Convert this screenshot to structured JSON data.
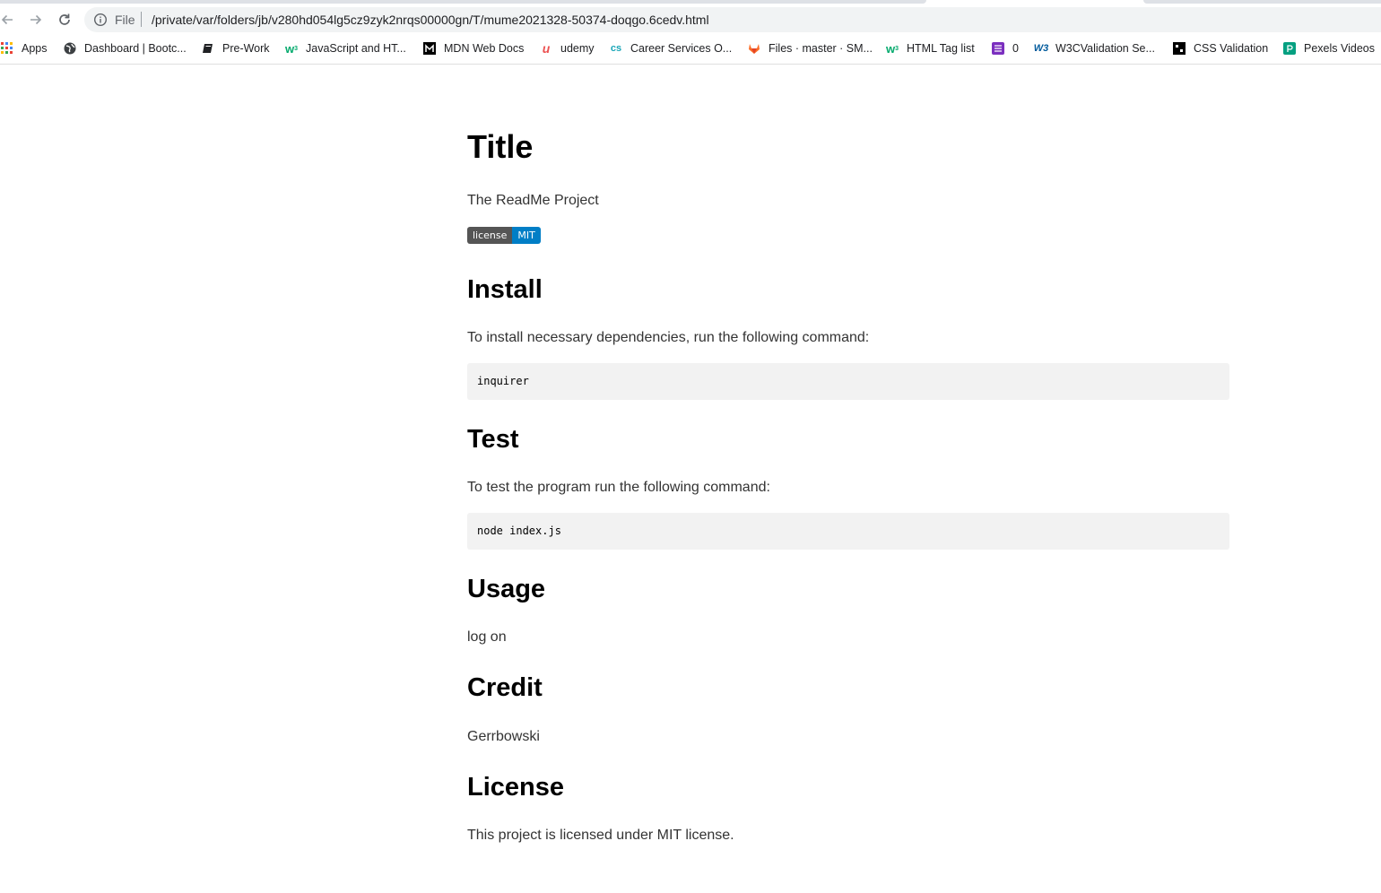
{
  "browser": {
    "address_scheme": "File",
    "address_url": "/private/var/folders/jb/v280hd054lg5cz9zyk2nrqs00000gn/T/mume2021328-50374-doqgo.6cedv.html",
    "bookmarks": [
      {
        "label": "Apps",
        "icon": "apps-grid-icon"
      },
      {
        "label": "Dashboard | Bootc...",
        "icon": "globe-icon"
      },
      {
        "label": "Pre-Work",
        "icon": "book-icon"
      },
      {
        "label": "JavaScript and HT...",
        "icon": "w3schools-icon"
      },
      {
        "label": "MDN Web Docs",
        "icon": "mdn-icon"
      },
      {
        "label": "udemy",
        "icon": "udemy-icon"
      },
      {
        "label": "Career Services O...",
        "icon": "cs-icon"
      },
      {
        "label": "Files · master · SM...",
        "icon": "gitlab-icon"
      },
      {
        "label": "HTML Tag list",
        "icon": "w3schools-icon"
      },
      {
        "label": "0",
        "icon": "list-icon"
      },
      {
        "label": "W3CValidation Se...",
        "icon": "w3c-icon"
      },
      {
        "label": "CSS Validation",
        "icon": "css-validation-icon"
      },
      {
        "label": "Pexels Videos",
        "icon": "pexels-icon"
      }
    ]
  },
  "readme": {
    "title_heading": "Title",
    "title_text": "The ReadMe Project",
    "badge": {
      "label": "license",
      "value": "MIT",
      "label_color": "#555555",
      "value_color": "#007ec6"
    },
    "install_heading": "Install",
    "install_text": "To install necessary dependencies, run the following command:",
    "install_code": "inquirer",
    "test_heading": "Test",
    "test_text": "To test the program run the following command:",
    "test_code": "node index.js",
    "usage_heading": "Usage",
    "usage_text": "log on",
    "credit_heading": "Credit",
    "credit_text": "Gerrbowski",
    "license_heading": "License",
    "license_text": "This project is licensed under MIT license."
  }
}
